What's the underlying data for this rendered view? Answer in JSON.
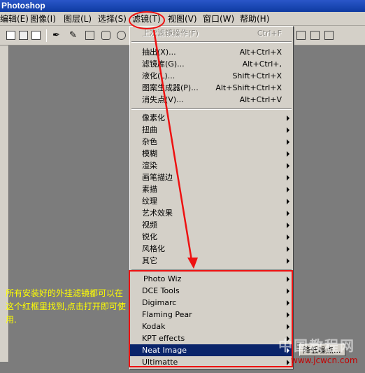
{
  "app": {
    "title": "Photoshop"
  },
  "menubar": {
    "items": [
      {
        "label": "编辑(E)"
      },
      {
        "label": "图像(I)"
      },
      {
        "label": "图层(L)"
      },
      {
        "label": "选择(S)"
      },
      {
        "label": "滤镜(T)"
      },
      {
        "label": "视图(V)"
      },
      {
        "label": "窗口(W)"
      },
      {
        "label": "帮助(H)"
      }
    ]
  },
  "filter_menu": {
    "last_filter": {
      "label": "上次滤镜操作(F)",
      "shortcut": "Ctrl+F"
    },
    "group1": [
      {
        "label": "抽出(X)...",
        "shortcut": "Alt+Ctrl+X"
      },
      {
        "label": "滤镜库(G)...",
        "shortcut": "Alt+Ctrl+,"
      },
      {
        "label": "液化(L)...",
        "shortcut": "Shift+Ctrl+X"
      },
      {
        "label": "图案生成器(P)...",
        "shortcut": "Alt+Shift+Ctrl+X"
      },
      {
        "label": "消失点(V)...",
        "shortcut": "Alt+Ctrl+V"
      }
    ],
    "group2": [
      {
        "label": "像素化"
      },
      {
        "label": "扭曲"
      },
      {
        "label": "杂色"
      },
      {
        "label": "模糊"
      },
      {
        "label": "渲染"
      },
      {
        "label": "画笔描边"
      },
      {
        "label": "素描"
      },
      {
        "label": "纹理"
      },
      {
        "label": "艺术效果"
      },
      {
        "label": "视频"
      },
      {
        "label": "锐化"
      },
      {
        "label": "风格化"
      },
      {
        "label": "其它"
      }
    ],
    "plugins": [
      {
        "label": "Photo Wiz"
      },
      {
        "label": "DCE Tools"
      },
      {
        "label": "Digimarc"
      },
      {
        "label": "Flaming Pear"
      },
      {
        "label": "Kodak"
      },
      {
        "label": "KPT effects"
      },
      {
        "label": "Neat Image"
      },
      {
        "label": "Ultimatte"
      }
    ]
  },
  "submenu": {
    "label": "降低噪点..."
  },
  "annotation": {
    "text": "所有安装好的外挂滤镜都可以在这个红框里找到,点击打开即可使用."
  },
  "watermark": {
    "cn": "中国教程网",
    "url": "www.jcwcn.com"
  },
  "colors": {
    "highlight": "#0a246a",
    "annotation_red": "#e11111",
    "annotation_text": "#ffff00"
  }
}
